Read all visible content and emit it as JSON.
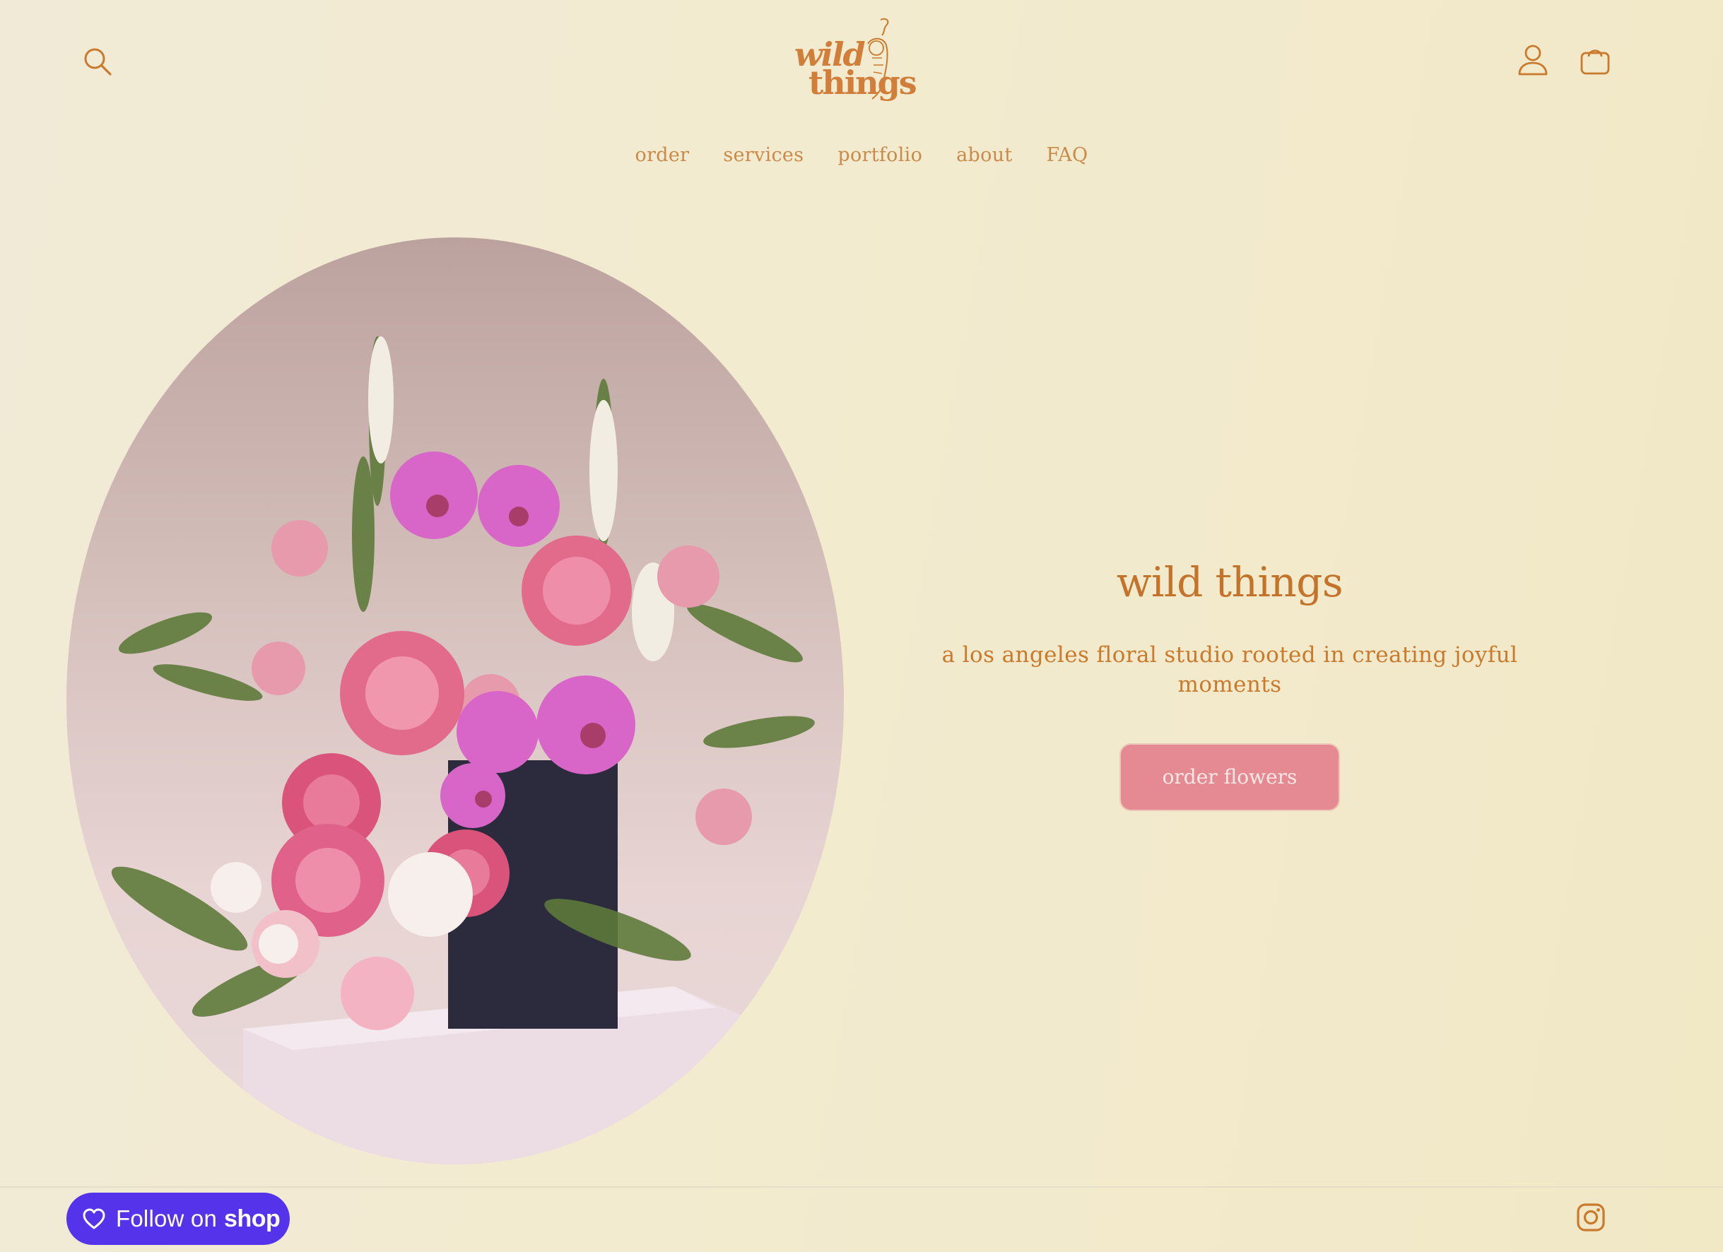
{
  "header": {
    "logo": {
      "line1": "wild",
      "line2": "things"
    },
    "nav": [
      {
        "label": "order"
      },
      {
        "label": "services"
      },
      {
        "label": "portfolio"
      },
      {
        "label": "about"
      },
      {
        "label": "FAQ"
      }
    ],
    "icons": {
      "search": "search-icon",
      "account": "user-icon",
      "cart": "cart-icon"
    }
  },
  "hero": {
    "image": "floral-arrangement-photo",
    "title": "wild things",
    "subtitle": "a los angeles floral studio rooted in creating joyful moments",
    "button_label": "order flowers"
  },
  "footer": {
    "follow_label": "Follow on",
    "follow_brand": "shop",
    "social_icon": "instagram-icon"
  },
  "colors": {
    "accent": "#c97a2c",
    "button": "#e58a93",
    "shop": "#5433eb",
    "background": "#f1ead6"
  }
}
